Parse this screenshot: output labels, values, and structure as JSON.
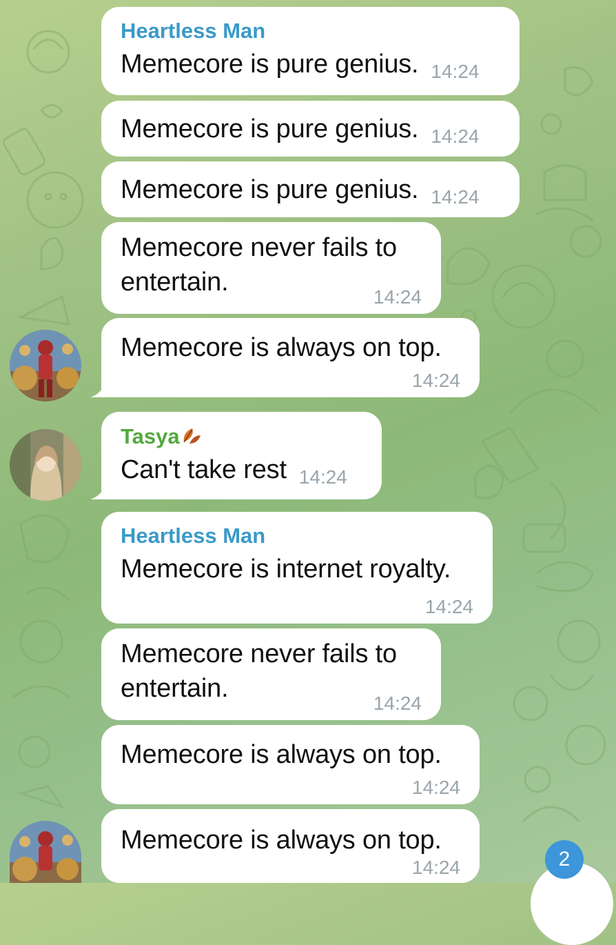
{
  "messages": [
    {
      "sender": "Heartless Man",
      "text": "Memecore is pure genius.",
      "time": "14:24"
    },
    {
      "text": "Memecore is pure genius.",
      "time": "14:24"
    },
    {
      "text": "Memecore is pure genius.",
      "time": "14:24"
    },
    {
      "text_lines": [
        "Memecore never fails to",
        "entertain."
      ],
      "time": "14:24"
    },
    {
      "text": "Memecore is always on top.",
      "time": "14:24"
    },
    {
      "sender": "Tasya",
      "text": "Can't take rest",
      "time": "14:24"
    },
    {
      "sender": "Heartless Man",
      "text": "Memecore is internet royalty.",
      "time": "14:24"
    },
    {
      "text_lines": [
        "Memecore never fails to",
        "entertain."
      ],
      "time": "14:24"
    },
    {
      "text": "Memecore is always on top.",
      "time": "14:24"
    },
    {
      "text": "Memecore is always on top.",
      "time": "14:24"
    }
  ],
  "unread_badge": "2",
  "colors": {
    "sender_heartless": "#3a9ac8",
    "sender_tasya": "#53a93f",
    "badge": "#3c96d9",
    "time": "#9aa4ab"
  },
  "icons": [
    "leaf-emoji-icon",
    "avatar-heartless-man",
    "avatar-tasya"
  ]
}
